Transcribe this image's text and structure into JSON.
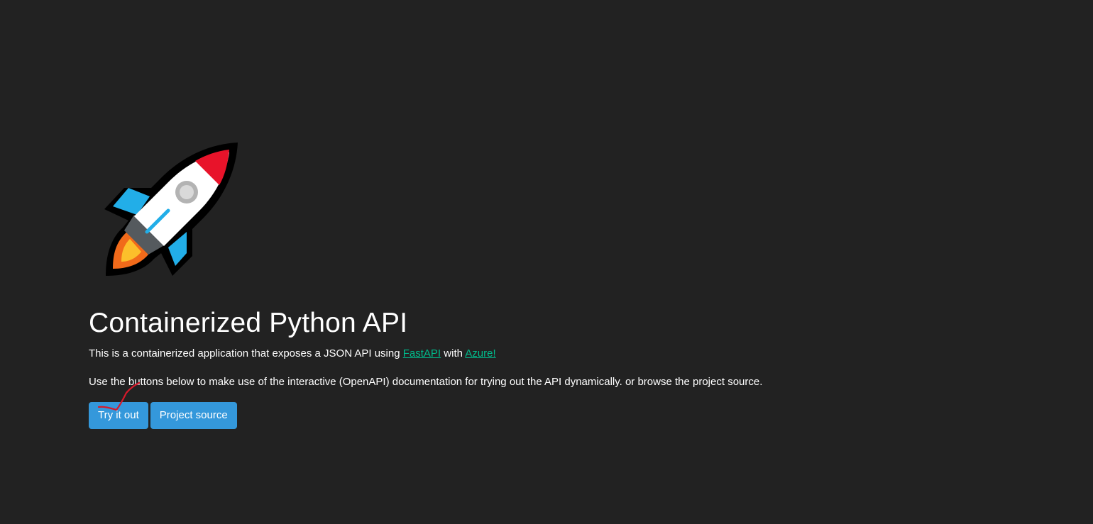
{
  "logo": {
    "icon": "rocket-icon",
    "colors": {
      "outline": "#000000",
      "body": "#ffffff",
      "nose": "#e8132a",
      "fins": "#22aee8",
      "window": "#b3b3b3",
      "exhaust_outer": "#f16a1a",
      "exhaust_inner": "#fcbf2b",
      "base": "#555a5e"
    }
  },
  "hero": {
    "title": "Containerized Python API",
    "intro": {
      "before": "This is a containerized application that exposes a JSON API using ",
      "fastapi_link": "FastAPI",
      "middle": " with ",
      "azure_link": "Azure!"
    },
    "usage": "Use the buttons below to make use of the interactive (OpenAPI) documentation for trying out the API dynamically. or browse the project source."
  },
  "buttons": {
    "try_label": "Try it out",
    "source_label": "Project source"
  },
  "colors": {
    "background": "#222222",
    "link": "#00bc8c",
    "button": "#3498db",
    "annotation": "#d7192a"
  }
}
